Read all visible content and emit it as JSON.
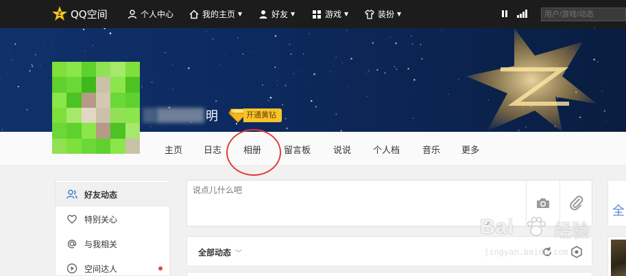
{
  "topbar": {
    "logo_text": "QQ空间",
    "nav": [
      {
        "label": "个人中心",
        "has_caret": false
      },
      {
        "label": "我的主页",
        "has_caret": true
      },
      {
        "label": "好友",
        "has_caret": true
      },
      {
        "label": "游戏",
        "has_caret": true
      },
      {
        "label": "装扮",
        "has_caret": true
      }
    ],
    "search_placeholder": "用户/游戏/动态"
  },
  "profile": {
    "name_visible_tail": "明",
    "vip_label": "开通黄钻"
  },
  "tabs": [
    "主页",
    "日志",
    "相册",
    "留言板",
    "说说",
    "个人档",
    "音乐",
    "更多"
  ],
  "sidebar": {
    "items": [
      {
        "label": "好友动态",
        "active": true,
        "dot": false
      },
      {
        "label": "特别关心",
        "active": false,
        "dot": false
      },
      {
        "label": "与我相关",
        "active": false,
        "dot": false
      },
      {
        "label": "空间达人",
        "active": false,
        "dot": true
      }
    ]
  },
  "post": {
    "placeholder": "说点儿什么吧"
  },
  "feed": {
    "filter_label": "全部动态"
  },
  "watermark": {
    "main": "Bai",
    "cn": "经验",
    "sub": "jingyan.baidu.com"
  },
  "colors": {
    "topbar": "#1c1c1c",
    "banner": "#10316b",
    "vip": "#f6c52b",
    "annotation_circle": "#e03a3a",
    "red_dot": "#e04a4a"
  }
}
